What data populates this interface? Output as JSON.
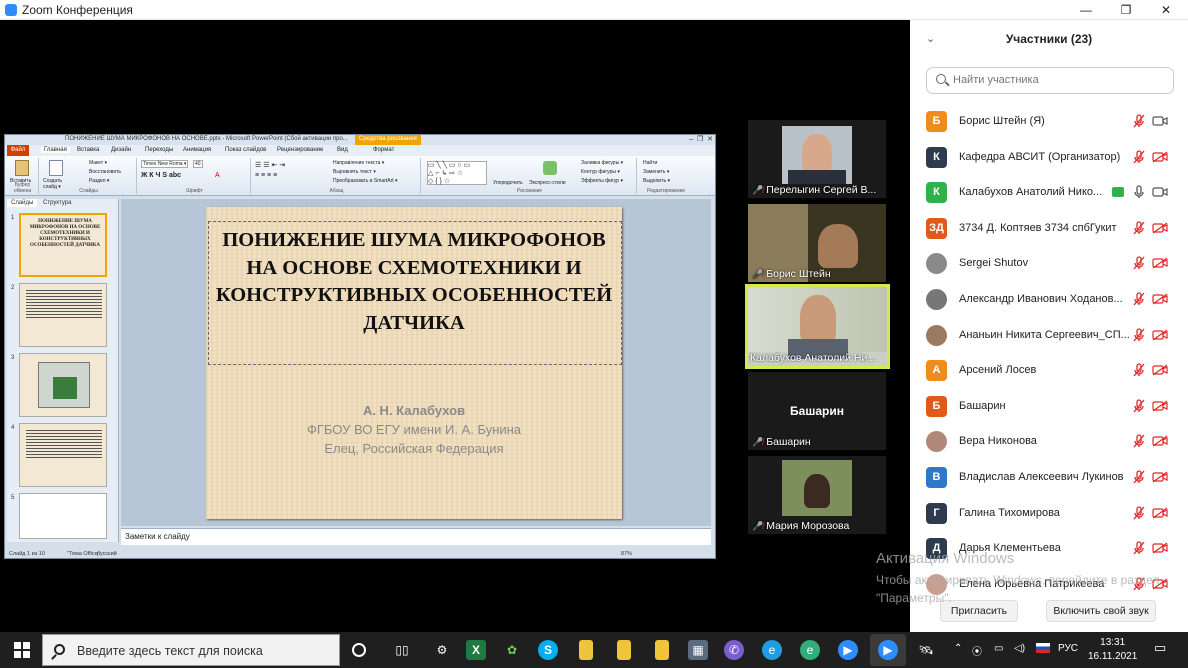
{
  "window": {
    "title": "Zoom Конференция",
    "minimize": "—",
    "maximize": "❐",
    "close": "✕"
  },
  "ppt": {
    "title_mid": "ПОНИЖЕНИЕ ШУМА МИКРОФОНОВ НА ОСНОВЕ.pptx - Microsoft PowerPoint (Сбой активации про...",
    "context_tab": "Средства рисования",
    "tabs": [
      "Файл",
      "Главная",
      "Вставка",
      "Дизайн",
      "Переходы",
      "Анимация",
      "Показ слайдов",
      "Рецензирование",
      "Вид",
      "Формат"
    ],
    "ribbon": {
      "paste": "Вставить",
      "clipboard": "Буфер обмена",
      "layout": "Макет ▾",
      "restore": "Восстановить",
      "section": "Раздел ▾",
      "new_slide": "Создать слайд ▾",
      "slides": "Слайды",
      "font_name": "Times New Roma ▾",
      "font_size": "40",
      "font": "Шрифт",
      "para": "Абзац",
      "text_dir": "Направление текста ▾",
      "align_text": "Выровнять текст ▾",
      "smartart": "Преобразовать в SmartArt ▾",
      "arrange": "Упорядочить",
      "quick_styles": "Экспресс-стили",
      "drawing": "Рисование",
      "fill": "Заливка фигуры ▾",
      "outline": "Контур фигуры ▾",
      "effects": "Эффекты фигур ▾",
      "find": "Найти",
      "replace": "Заменить ▾",
      "select": "Выделить ▾",
      "editing": "Редактирование"
    },
    "left_tabs": [
      "Слайды",
      "Структура"
    ],
    "thumb1_title": "ПОНИЖЕНИЕ ШУМА МИКРОФОНОВ НА ОСНОВЕ СХЕМОТЕХНИКИ И КОНСТРУКТИВНЫХ ОСОБЕННОСТЕЙ ДАТЧИКА",
    "thumb_nums": [
      "1",
      "2",
      "3",
      "4",
      "5"
    ],
    "slide": {
      "title": "ПОНИЖЕНИЕ ШУМА МИКРОФОНОВ НА ОСНОВЕ СХЕМОТЕХНИКИ И КОНСТРУКТИВНЫХ ОСОБЕННОСТЕЙ ДАТЧИКА",
      "author": "А. Н. Калабухов",
      "org": "ФГБОУ ВО ЕГУ имени И. А. Бунина",
      "city": "Елец, Российская Федерация"
    },
    "notes": "Заметки к слайду",
    "status": {
      "slide": "Слайд 1 из 10",
      "theme": "\"Тема Office\"",
      "lang": "русский",
      "zoom": "87%"
    }
  },
  "videos": [
    {
      "name": "Перелыгин Сергей В...",
      "muted": true
    },
    {
      "name": "Борис Штейн",
      "muted": true
    },
    {
      "name": "Калабухов Анатолий Ни...",
      "muted": false
    },
    {
      "name": "Башарин",
      "label": "Башарин",
      "muted": true
    },
    {
      "name": "Мария Морозова",
      "muted": true
    }
  ],
  "participants": {
    "header": "Участники (23)",
    "search_placeholder": "Найти участника",
    "list": [
      {
        "initials": "Б",
        "color": "#f08c1c",
        "name": "Борис Штейн (Я)",
        "mic": "muted",
        "cam": "on"
      },
      {
        "initials": "К",
        "color": "#2e3b4e",
        "name": "Кафедра АВСИТ (Организатор)",
        "mic": "muted",
        "cam": "off"
      },
      {
        "initials": "К",
        "color": "#2fb24b",
        "name": "Калабухов Анатолий Нико...",
        "mic": "on",
        "cam": "on",
        "share": true
      },
      {
        "initials": "ЗД",
        "color": "#e05a1a",
        "name": "3734 Д. Коптяев 3734 спбГукит",
        "mic": "muted",
        "cam": "off"
      },
      {
        "initials": "",
        "color": "#8a8a8a",
        "name": "Sergei Shutov",
        "mic": "muted",
        "cam": "off"
      },
      {
        "initials": "",
        "color": "#777777",
        "name": "Александр Иванович Ходанов...",
        "mic": "muted",
        "cam": "off"
      },
      {
        "initials": "",
        "color": "#9a7a62",
        "name": "Ананьин Никита Сергеевич_СП...",
        "mic": "muted",
        "cam": "off"
      },
      {
        "initials": "А",
        "color": "#f08c1c",
        "name": "Арсений Лосев",
        "mic": "muted",
        "cam": "off"
      },
      {
        "initials": "Б",
        "color": "#e05a1a",
        "name": "Башарин",
        "mic": "muted",
        "cam": "off"
      },
      {
        "initials": "",
        "color": "#b08878",
        "name": "Вера Никонова",
        "mic": "muted",
        "cam": "off"
      },
      {
        "initials": "В",
        "color": "#2d79c7",
        "name": "Владислав Алексеевич Лукинов",
        "mic": "muted",
        "cam": "off"
      },
      {
        "initials": "Г",
        "color": "#2e3b4e",
        "name": "Галина Тихомирова",
        "mic": "muted",
        "cam": "off"
      },
      {
        "initials": "Д",
        "color": "#2e3b4e",
        "name": "Дарья Клементьева",
        "mic": "muted",
        "cam": "off"
      },
      {
        "initials": "",
        "color": "#c9a090",
        "name": "Елена Юрьевна Патрикеева",
        "mic": "muted",
        "cam": "off"
      }
    ],
    "invite": "Пригласить",
    "unmute": "Включить свой звук"
  },
  "watermark": {
    "line1": "Активация Windows",
    "line2": "Чтобы активировать Windows, перейдите в раздел \"Параметры\"."
  },
  "taskbar": {
    "search": "Введите здесь текст для поиска",
    "lang": "РУС",
    "time": "13:31",
    "date": "16.11.2021"
  }
}
